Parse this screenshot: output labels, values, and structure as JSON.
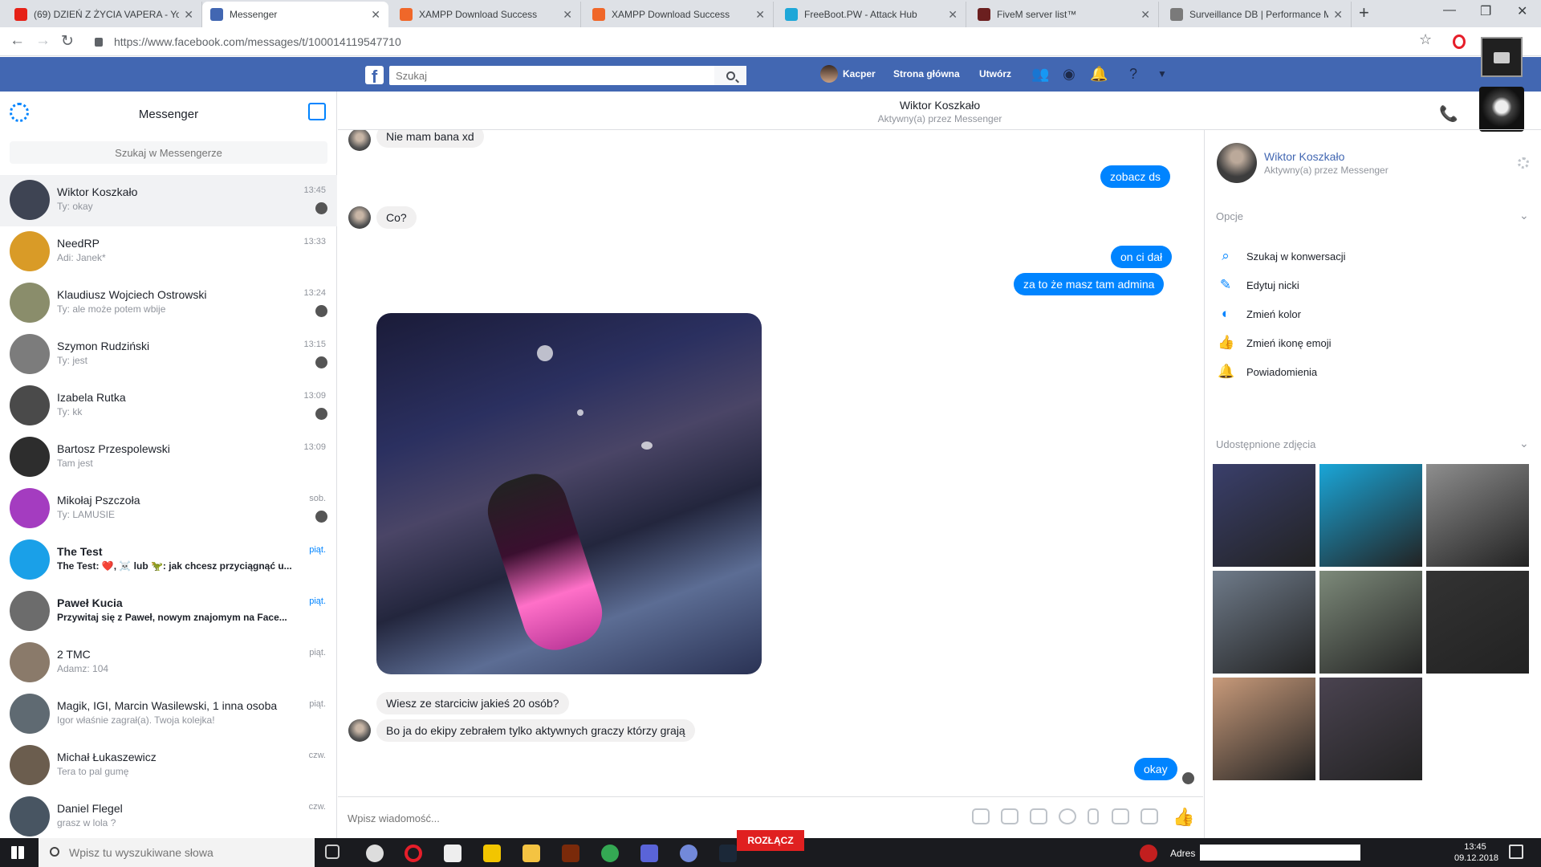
{
  "browser": {
    "tabs": [
      {
        "label": "(69) DZIEŃ Z ŻYCIA VAPERA - Yo",
        "color": "#e62117"
      },
      {
        "label": "Messenger",
        "color": "#4267b2"
      },
      {
        "label": "XAMPP Download Success",
        "color": "#f06729"
      },
      {
        "label": "XAMPP Download Success",
        "color": "#f06729"
      },
      {
        "label": "FreeBoot.PW - Attack Hub",
        "color": "#1ea7d8"
      },
      {
        "label": "FiveM server list™",
        "color": "#6b1f1f"
      },
      {
        "label": "Surveillance DB | Performance M",
        "color": "#7a7a7a"
      }
    ],
    "url": "https://www.facebook.com/messages/t/100014119547710"
  },
  "facebook": {
    "search_placeholder": "Szukaj",
    "user": "Kacper",
    "home": "Strona główna",
    "create": "Utwórz"
  },
  "sidebar": {
    "title": "Messenger",
    "search_placeholder": "Szukaj w Messengerze",
    "conversations": [
      {
        "name": "Wiktor Koszkało",
        "preview": "Ty: okay",
        "time": "13:45",
        "bold": false,
        "color": "#3e4453",
        "seen": true
      },
      {
        "name": "NeedRP",
        "preview": "Adi: Janek*",
        "time": "13:33",
        "bold": false,
        "color": "#d99b27",
        "seen": false
      },
      {
        "name": "Klaudiusz Wojciech Ostrowski",
        "preview": "Ty: ale może potem wbije",
        "time": "13:24",
        "bold": false,
        "color": "#8a8d6b",
        "seen": true
      },
      {
        "name": "Szymon Rudziński",
        "preview": "Ty: jest",
        "time": "13:15",
        "bold": false,
        "color": "#7c7c7c",
        "seen": true
      },
      {
        "name": "Izabela Rutka",
        "preview": "Ty: kk",
        "time": "13:09",
        "bold": false,
        "color": "#4a4a4a",
        "seen": true
      },
      {
        "name": "Bartosz Przespolewski",
        "preview": "Tam jest",
        "time": "13:09",
        "bold": false,
        "color": "#2d2d2d",
        "seen": false
      },
      {
        "name": "Mikołaj Pszczoła",
        "preview": "Ty: LAMUSIE",
        "time": "sob.",
        "bold": false,
        "color": "#a43cc0",
        "seen": true
      },
      {
        "name": "The Test",
        "preview": "The Test: ❤️, ☠️ lub 🦖: jak chcesz przyciągnąć u...",
        "time": "piąt.",
        "bold": true,
        "color": "#1aa0e8",
        "seen": false
      },
      {
        "name": "Paweł Kucia",
        "preview": "Przywitaj się z Paweł, nowym znajomym na Face...",
        "time": "piąt.",
        "bold": true,
        "color": "#6c6c6c",
        "seen": false
      },
      {
        "name": "2 TMC",
        "preview": "Adamz: 104",
        "time": "piąt.",
        "bold": false,
        "color": "#8a7a6a",
        "seen": false
      },
      {
        "name": "Magik, IGI, Marcin Wasilewski, 1 inna osoba",
        "preview": "Igor właśnie zagrał(a). Twoja kolejka!",
        "time": "piąt.",
        "bold": false,
        "color": "#5f6a72",
        "seen": false
      },
      {
        "name": "Michał Łukaszewicz",
        "preview": "Tera to pal gumę",
        "time": "czw.",
        "bold": false,
        "color": "#6b5d4e",
        "seen": false
      },
      {
        "name": "Daniel Flegel",
        "preview": "grasz w lola ?",
        "time": "czw.",
        "bold": false,
        "color": "#485562",
        "seen": false
      }
    ]
  },
  "chat": {
    "name": "Wiktor Koszkało",
    "status": "Aktywny(a) przez Messenger",
    "messages": [
      {
        "text": "Nie mam bana xd"
      },
      {
        "text": "zobacz ds"
      },
      {
        "text": "Co?"
      },
      {
        "text": "on ci dał"
      },
      {
        "text": "za to że masz tam admina"
      },
      {
        "text": "Wiesz ze starciciw jakieś 20 osób?"
      },
      {
        "text": "Bo ja do ekipy zebrałem tylko aktywnych graczy którzy grają"
      },
      {
        "text": "okay"
      }
    ],
    "composer_placeholder": "Wpisz wiadomość..."
  },
  "right_panel": {
    "name": "Wiktor Koszkało",
    "status": "Aktywny(a) przez Messenger",
    "options_title": "Opcje",
    "options": [
      {
        "label": "Szukaj w konwersacji",
        "icon": "search-icon"
      },
      {
        "label": "Edytuj nicki",
        "icon": "pencil-icon"
      },
      {
        "label": "Zmień kolor",
        "icon": "palette-icon"
      },
      {
        "label": "Zmień ikonę emoji",
        "icon": "thumbs-up-icon"
      },
      {
        "label": "Powiadomienia",
        "icon": "bell-icon"
      }
    ],
    "photos_title": "Udostępnione zdjęcia",
    "photo_colors": [
      "#3a3f6b",
      "#1aa6d8",
      "#8e8e8e",
      "#6f7b8a",
      "#7d8a7a",
      "#333333",
      "#c89a7a",
      "#4a4350"
    ]
  },
  "taskbar": {
    "search_placeholder": "Wpisz tu wyszukiwane słowa",
    "rozlacz": "ROZŁĄCZ",
    "address_label": "Adres",
    "time": "13:45",
    "date": "09.12.2018"
  }
}
